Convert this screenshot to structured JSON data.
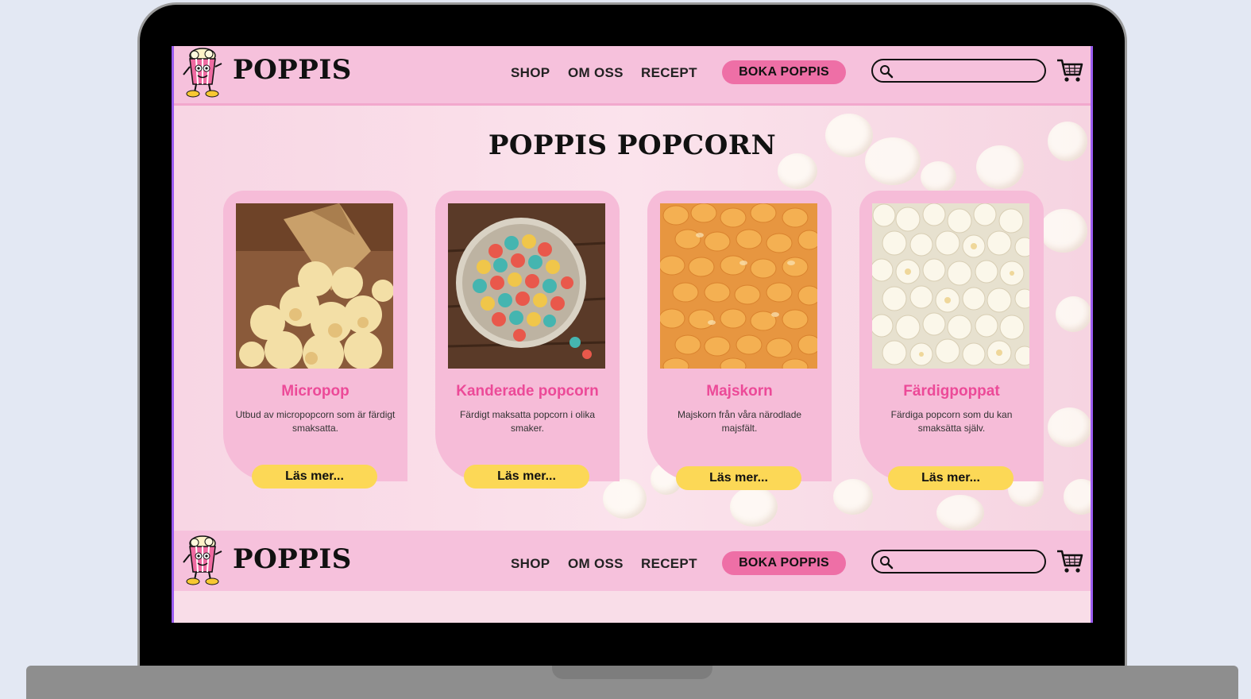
{
  "header": {
    "brand": "POPPIS",
    "nav": {
      "shop": "SHOP",
      "om_oss": "OM OSS",
      "recept": "RECEPT"
    },
    "cta": "BOKA POPPIS",
    "search_placeholder": "",
    "icons": [
      "mascot-logo",
      "search-icon",
      "cart-icon"
    ]
  },
  "hero": {
    "title": "POPPIS POPCORN",
    "cards": [
      {
        "title": "Micropop",
        "description": "Utbud av micropopcorn som är färdigt smaksatta.",
        "button": "Läs mer...",
        "image": "spilled-popcorn-bag"
      },
      {
        "title": "Kanderade popcorn",
        "description": "Färdigt maksatta popcorn i olika smaker.",
        "button": "Läs mer...",
        "image": "colorful-candied-popcorn-bowl"
      },
      {
        "title": "Majskorn",
        "description": "Majskorn från våra närodlade majsfält.",
        "button": "Läs mer...",
        "image": "corn-kernels"
      },
      {
        "title": "Färdigpoppat",
        "description": "Färdiga popcorn som du kan smaksätta själv.",
        "button": "Läs mer...",
        "image": "popped-popcorn"
      }
    ]
  },
  "colors": {
    "nav_bg": "#f6c1dc",
    "cta_bg": "#ee6fa6",
    "card_bg": "#f6bcd8",
    "card_title": "#ec4a98",
    "button_bg": "#fcd856",
    "accent_border": "#9b5cf0"
  }
}
